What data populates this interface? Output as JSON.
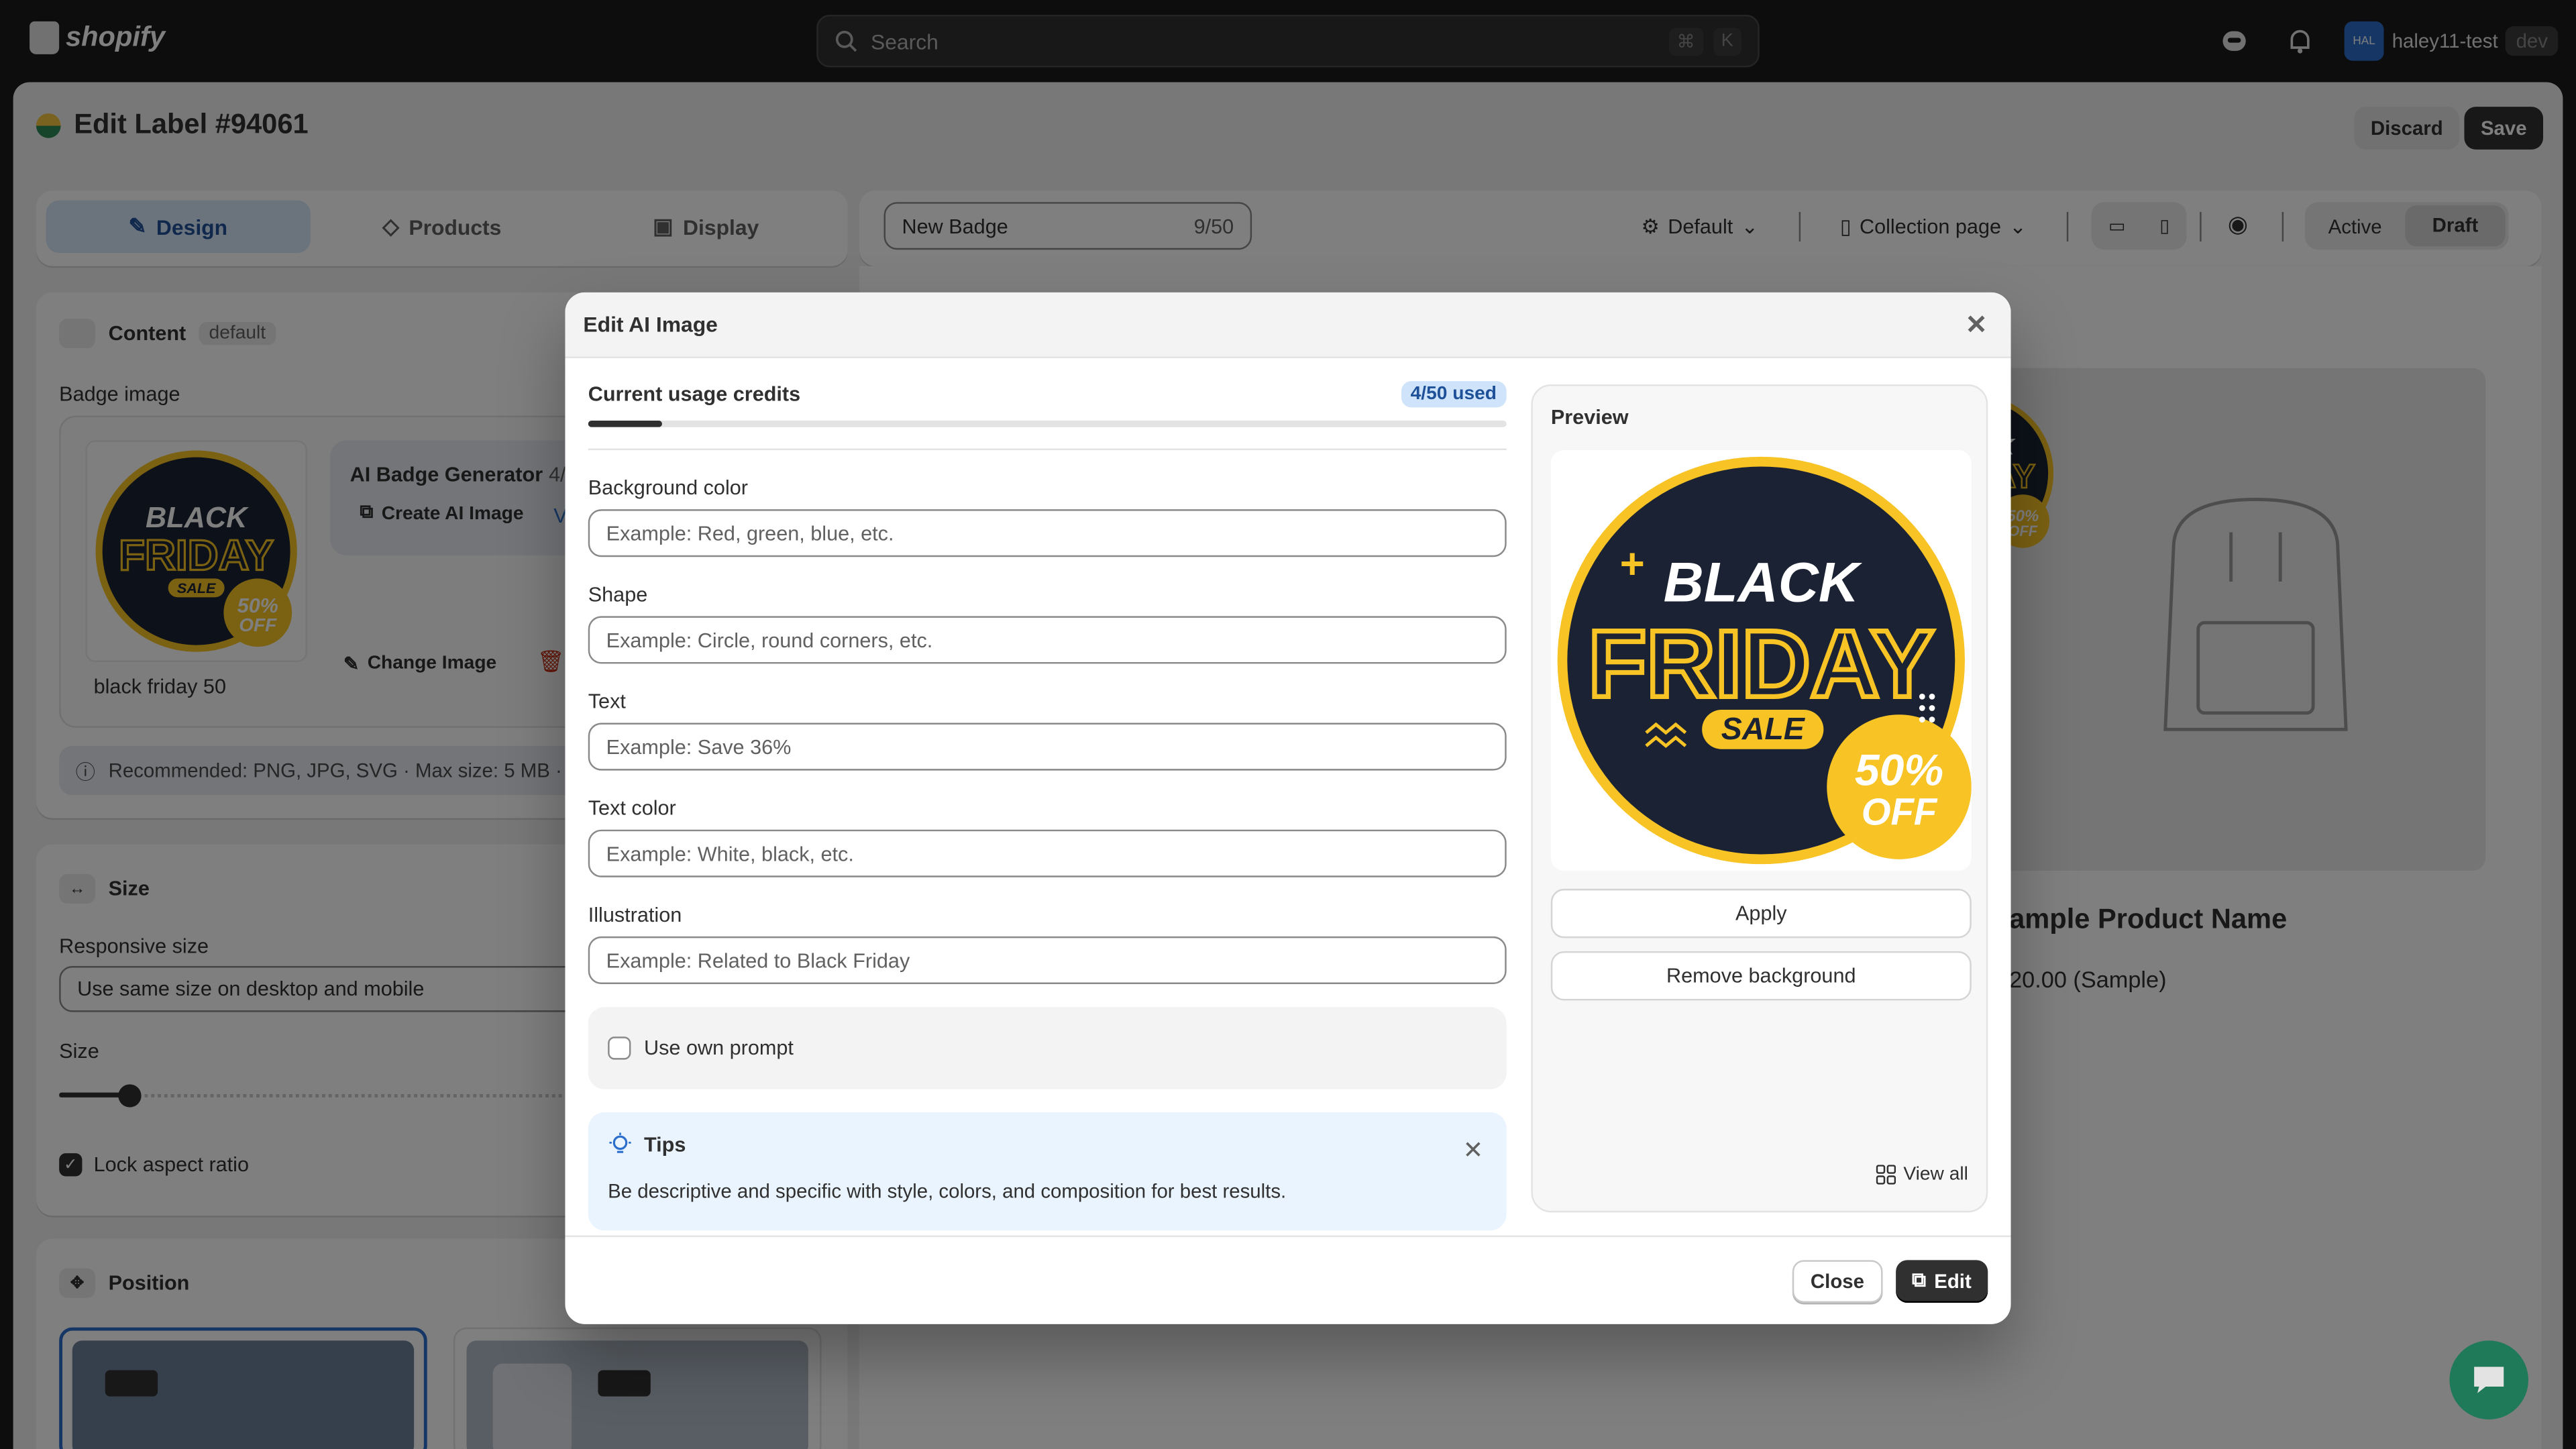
{
  "topbar": {
    "brand": "shopify",
    "search_placeholder": "Search",
    "shortcut_cmd": "⌘",
    "shortcut_key": "K",
    "avatar_initials": "HAL",
    "user_name": "haley11-test",
    "user_tag": "dev"
  },
  "page": {
    "title": "Edit Label #94061",
    "discard_label": "Discard",
    "save_label": "Save"
  },
  "tabs": [
    {
      "label": "Design",
      "active": true
    },
    {
      "label": "Products",
      "active": false
    },
    {
      "label": "Display",
      "active": false
    }
  ],
  "content_card": {
    "title": "Content",
    "title_tag": "default",
    "badge_image_label": "Badge image",
    "image_caption": "black friday 50",
    "generator_title": "AI Badge Generator",
    "generator_count": "4/",
    "create_label": "Create AI Image",
    "view_partial": "V",
    "change_image_label": "Change Image",
    "recommendation": "Recommended: PNG, JPG, SVG · Max size: 5 MB ·"
  },
  "size_card": {
    "title": "Size",
    "responsive_label": "Responsive size",
    "responsive_value": "Use same size on desktop and mobile",
    "size_label": "Size",
    "size_value_fraction": 0.13,
    "lock_label": "Lock aspect ratio",
    "lock_checked": true
  },
  "position_card": {
    "title": "Position"
  },
  "toolbar": {
    "badge_name": "New Badge",
    "badge_count": "9/50",
    "theme": "Default",
    "page_type": "Collection page",
    "status_active": "Active",
    "status_draft": "Draft"
  },
  "product": {
    "name_partial": "ample Product Name",
    "price_partial": "20.00 (Sample)"
  },
  "modal": {
    "title": "Edit AI Image",
    "credits_label": "Current usage credits",
    "credits_badge": "4/50 used",
    "credits_used_fraction": 0.08,
    "fields": [
      {
        "label": "Background color",
        "placeholder": "Example: Red, green, blue, etc."
      },
      {
        "label": "Shape",
        "placeholder": "Example: Circle, round corners, etc."
      },
      {
        "label": "Text",
        "placeholder": "Example: Save 36%"
      },
      {
        "label": "Text color",
        "placeholder": "Example: White, black, etc."
      },
      {
        "label": "Illustration",
        "placeholder": "Example: Related to Black Friday"
      }
    ],
    "own_prompt_label": "Use own prompt",
    "tips_title": "Tips",
    "tips_text": "Be descriptive and specific with style, colors, and composition for best results.",
    "preview_title": "Preview",
    "apply_label": "Apply",
    "remove_bg_label": "Remove background",
    "view_all_label": "View all",
    "close_label": "Close",
    "edit_label": "Edit"
  },
  "badge_art": {
    "line1": "BLACK",
    "line2": "FRIDAY",
    "line3": "SALE",
    "pct": "50%",
    "off": "OFF"
  },
  "colors": {
    "accent_dark": "#303030",
    "tab_active_bg": "#d6e6fb",
    "badge_navy": "#1b2233",
    "badge_yellow": "#f7c325"
  }
}
